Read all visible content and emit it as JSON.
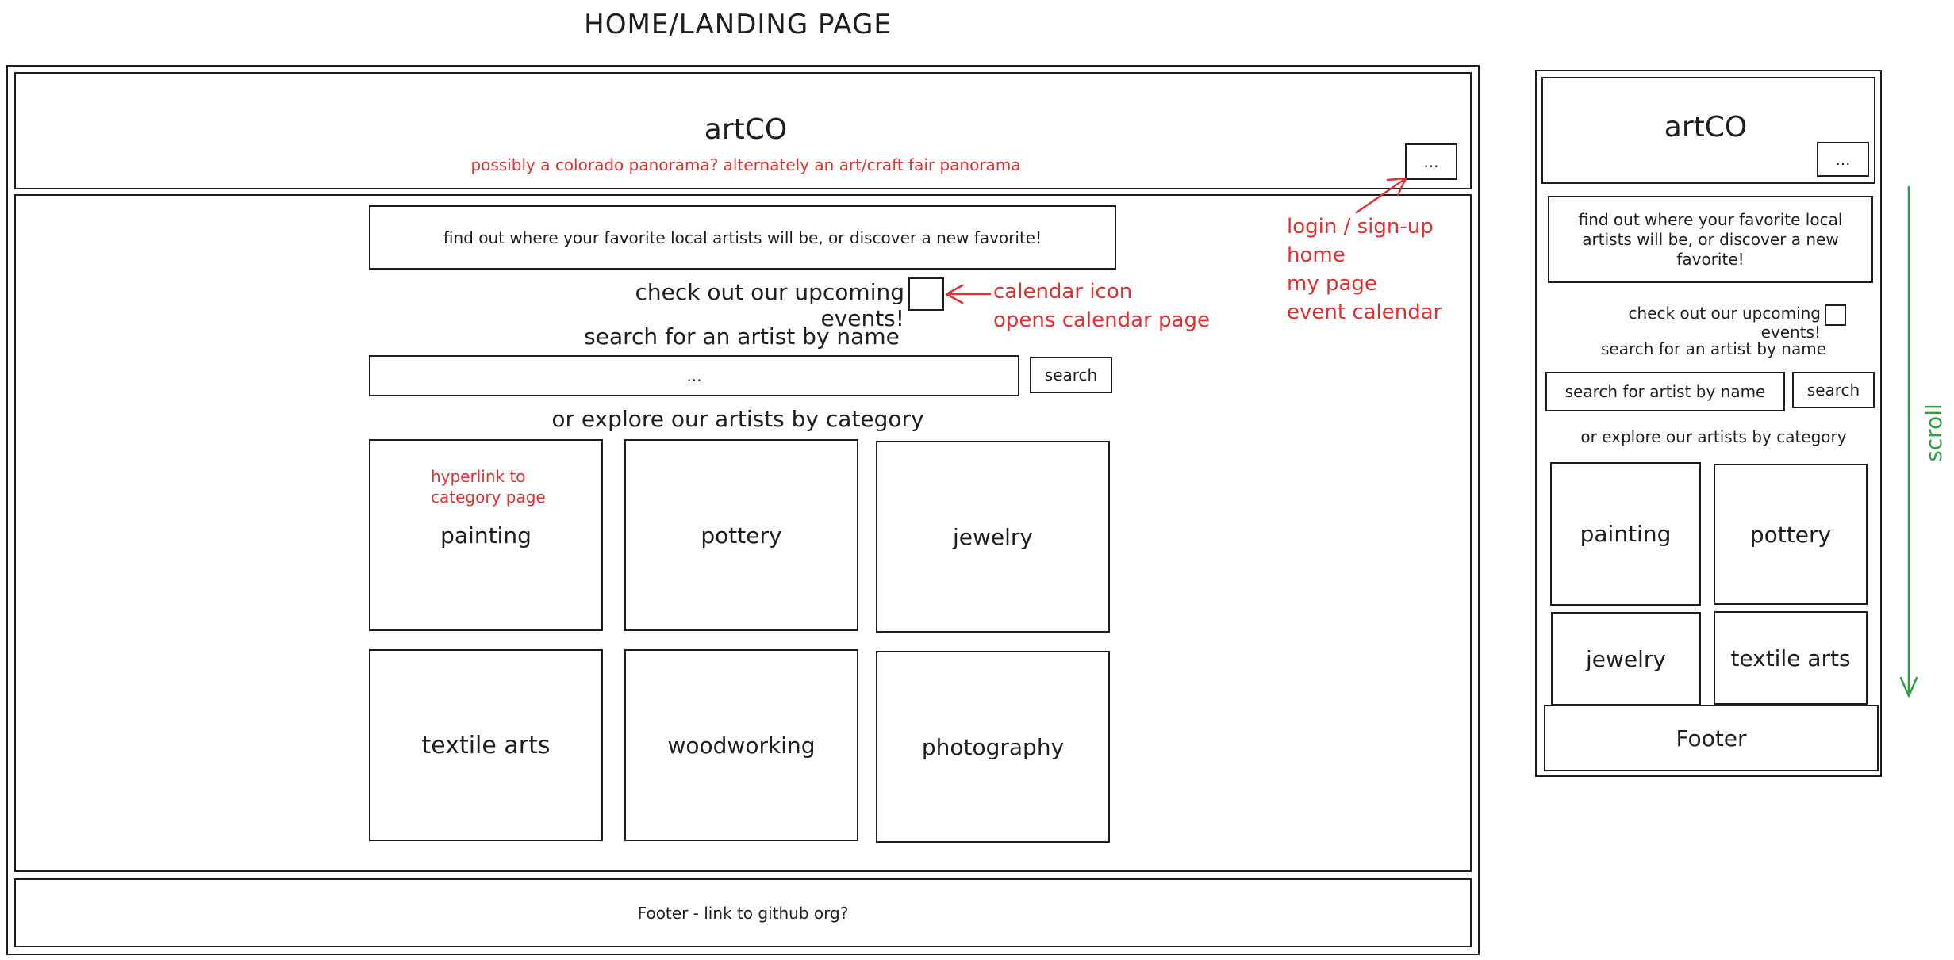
{
  "page_title": "HOME/LANDING PAGE",
  "desktop": {
    "logo": "artCO",
    "banner_note": "possibly a colorado panorama? alternately an art/craft fair panorama",
    "menu_button": "...",
    "tagline": "find out where your favorite local artists will be, or discover a new favorite!",
    "events_text": "check out our upcoming events!",
    "search_heading": "search for an artist by name",
    "search_value": "...",
    "search_button": "search",
    "explore_heading": "or explore our artists by category",
    "categories": [
      "painting",
      "pottery",
      "jewelry",
      "textile arts",
      "woodworking",
      "photography"
    ],
    "footer": "Footer - link to github org?"
  },
  "annotations": {
    "calendar_icon": "calendar icon",
    "calendar_opens": "opens calendar page",
    "hyperlink_line1": "hyperlink to",
    "hyperlink_line2": "category page",
    "menu_items": [
      "login / sign-up",
      "home",
      "my page",
      "event calendar"
    ]
  },
  "mobile": {
    "logo": "artCO",
    "menu_button": "...",
    "tagline": "find out where your favorite local artists will be, or discover a new favorite!",
    "events_text": "check out our upcoming events!",
    "search_heading": "search for an artist by name",
    "search_placeholder": "search for artist by name",
    "search_button": "search",
    "explore_heading": "or explore our artists by category",
    "categories": [
      "painting",
      "pottery",
      "jewelry",
      "textile arts"
    ],
    "footer": "Footer"
  },
  "scroll_label": "scroll",
  "colors": {
    "ink": "#1e1e1e",
    "annotation_red": "#e03131",
    "scroll_green": "#2f9e44"
  }
}
